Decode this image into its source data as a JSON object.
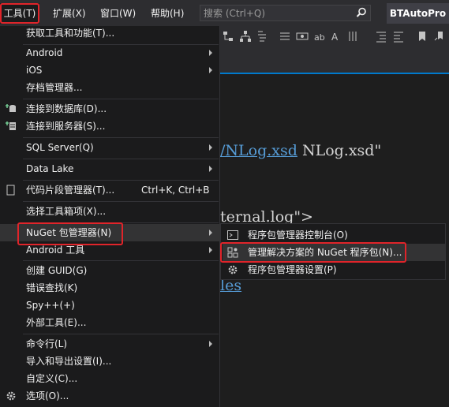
{
  "menubar": {
    "tools": "工具(T)",
    "extensions": "扩展(X)",
    "window": "窗口(W)",
    "help": "帮助(H)",
    "search_placeholder": "搜索 (Ctrl+Q)",
    "app_title": "BTAutoPro"
  },
  "editor": {
    "line1_link": "/NLog.xsd",
    "line1_rest": " NLog.xsd\"",
    "line2": "ternal.log\">",
    "line3_link": "les"
  },
  "tools_menu": {
    "get_tools": "获取工具和功能(T)...",
    "android": "Android",
    "ios": "iOS",
    "archive_manager": "存档管理器...",
    "connect_db": "连接到数据库(D)...",
    "connect_server": "连接到服务器(S)...",
    "sql_server": "SQL Server(Q)",
    "data_lake": "Data Lake",
    "snippet_manager": "代码片段管理器(T)...",
    "snippet_shortcut": "Ctrl+K, Ctrl+B",
    "choose_toolbox": "选择工具箱项(X)...",
    "nuget": "NuGet 包管理器(N)",
    "android_tools": "Android 工具",
    "create_guid": "创建 GUID(G)",
    "error_lookup": "错误查找(K)",
    "spy": "Spy++(+)",
    "external_tools": "外部工具(E)...",
    "command_line": "命令行(L)",
    "import_export": "导入和导出设置(I)...",
    "customize": "自定义(C)...",
    "options": "选项(O)..."
  },
  "nuget_submenu": {
    "console": "程序包管理器控制台(O)",
    "manage_solution": "管理解决方案的 NuGet 程序包(N)...",
    "settings": "程序包管理器设置(P)"
  },
  "colors": {
    "highlight_border": "#e0242a",
    "accent": "#007acc"
  }
}
